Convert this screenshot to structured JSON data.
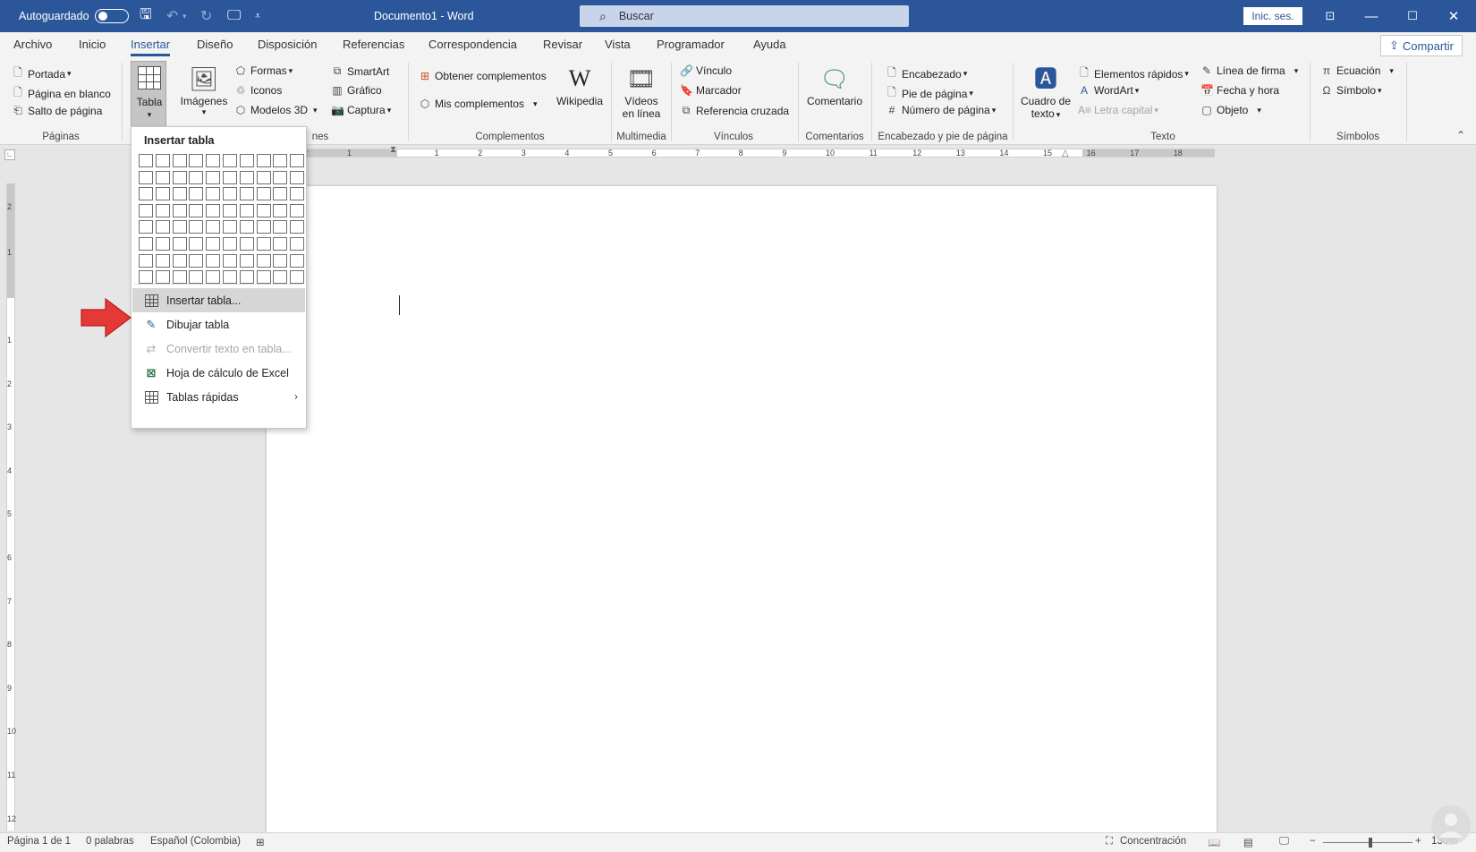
{
  "titlebar": {
    "autosave_label": "Autoguardado",
    "doc_title": "Documento1 - Word",
    "search_placeholder": "Buscar",
    "signin_label": "Inic. ses."
  },
  "tabs": [
    {
      "label": "Archivo"
    },
    {
      "label": "Inicio"
    },
    {
      "label": "Insertar",
      "active": true
    },
    {
      "label": "Diseño"
    },
    {
      "label": "Disposición"
    },
    {
      "label": "Referencias"
    },
    {
      "label": "Correspondencia"
    },
    {
      "label": "Revisar"
    },
    {
      "label": "Vista"
    },
    {
      "label": "Programador"
    },
    {
      "label": "Ayuda"
    }
  ],
  "share_label": "Compartir",
  "ribbon": {
    "paginas": {
      "items": [
        "Portada",
        "Página en blanco",
        "Salto de página"
      ],
      "label": "Páginas"
    },
    "tabla": {
      "label": "Tabla"
    },
    "ilustraciones": {
      "imagenes": "Imágenes",
      "formas": "Formas",
      "iconos": "Iconos",
      "modelos3d": "Modelos 3D",
      "smartart": "SmartArt",
      "grafico": "Gráfico",
      "captura": "Captura",
      "label_partial": "nes"
    },
    "complementos": {
      "obtener": "Obtener complementos",
      "mis": "Mis complementos",
      "wikipedia": "Wikipedia",
      "label": "Complementos"
    },
    "multimedia": {
      "videos_l1": "Vídeos",
      "videos_l2": "en línea",
      "label": "Multimedia"
    },
    "vinculos": {
      "vinculo": "Vínculo",
      "marcador": "Marcador",
      "referencia": "Referencia cruzada",
      "label": "Vínculos"
    },
    "comentarios": {
      "comentario": "Comentario",
      "label": "Comentarios"
    },
    "encabezado": {
      "encabezado": "Encabezado",
      "pie": "Pie de página",
      "numero": "Número de página",
      "label": "Encabezado y pie de página"
    },
    "texto": {
      "cuadro_l1": "Cuadro de",
      "cuadro_l2": "texto",
      "elementos": "Elementos rápidos",
      "wordart": "WordArt",
      "letra": "Letra capital",
      "linea": "Línea de firma",
      "fecha": "Fecha y hora",
      "objeto": "Objeto",
      "label": "Texto"
    },
    "simbolos": {
      "ecuacion": "Ecuación",
      "simbolo": "Símbolo",
      "label": "Símbolos"
    }
  },
  "ruler": {
    "h_numbers": [
      "2",
      "1",
      "1",
      "2",
      "3",
      "4",
      "5",
      "6",
      "7",
      "8",
      "9",
      "10",
      "11",
      "12",
      "13",
      "14",
      "15",
      "16",
      "17",
      "18"
    ],
    "v_numbers": [
      "2",
      "1",
      "1",
      "2",
      "3",
      "4",
      "5",
      "6",
      "7",
      "8",
      "9",
      "10",
      "11",
      "12"
    ]
  },
  "dropdown": {
    "title": "Insertar tabla",
    "grid_cols": 10,
    "grid_rows": 8,
    "items": [
      {
        "label": "Insertar tabla...",
        "icon": "table-icon",
        "hover": true
      },
      {
        "label": "Dibujar tabla",
        "icon": "pencil-table-icon"
      },
      {
        "label": "Convertir texto en tabla...",
        "icon": "convert-table-icon",
        "disabled": true
      },
      {
        "label": "Hoja de cálculo de Excel",
        "icon": "excel-icon"
      },
      {
        "label": "Tablas rápidas",
        "icon": "table-icon",
        "submenu": true
      }
    ]
  },
  "statusbar": {
    "page": "Página 1 de 1",
    "words": "0 palabras",
    "language": "Español (Colombia)",
    "focus": "Concentración",
    "zoom": "130%"
  },
  "colors": {
    "brand": "#2b579a",
    "ribbon_bg": "#f3f3f3",
    "arrow": "#e53935"
  }
}
